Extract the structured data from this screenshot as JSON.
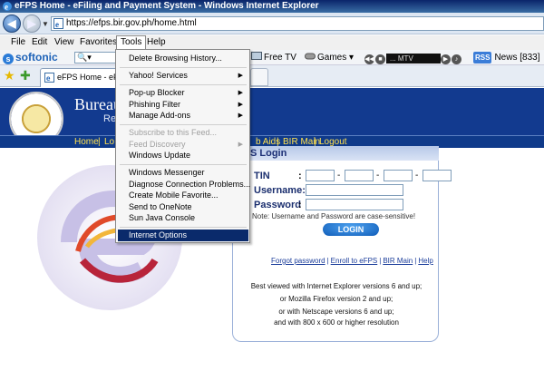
{
  "window": {
    "title": "eFPS Home - eFiling and Payment System - Windows Internet Explorer",
    "address": "https://efps.bir.gov.ph/home.html"
  },
  "menubar": [
    "File",
    "Edit",
    "View",
    "Favorites",
    "Tools",
    "Help"
  ],
  "toolbar": {
    "brand": "softonic",
    "free_tv": "Free TV",
    "games": "Games",
    "mtv": "... MTV",
    "news": "News [833]",
    "rss": "RSS"
  },
  "tabs": [
    {
      "label": "eFPS Home - eFiling..."
    }
  ],
  "tools_menu": {
    "items": [
      {
        "label": "Delete Browsing History...",
        "disabled": false,
        "submenu": false
      },
      {
        "label": "Yahoo! Services",
        "disabled": false,
        "submenu": true
      },
      {
        "label": "Pop-up Blocker",
        "disabled": false,
        "submenu": true
      },
      {
        "label": "Phishing Filter",
        "disabled": false,
        "submenu": true
      },
      {
        "label": "Manage Add-ons",
        "disabled": false,
        "submenu": true
      },
      {
        "label": "Subscribe to this Feed...",
        "disabled": true,
        "submenu": false
      },
      {
        "label": "Feed Discovery",
        "disabled": true,
        "submenu": true
      },
      {
        "label": "Windows Update",
        "disabled": false,
        "submenu": false
      },
      {
        "label": "Windows Messenger",
        "disabled": false,
        "submenu": false
      },
      {
        "label": "Diagnose Connection Problems...",
        "disabled": false,
        "submenu": false
      },
      {
        "label": "Create Mobile Favorite...",
        "disabled": false,
        "submenu": false
      },
      {
        "label": "Send to OneNote",
        "disabled": false,
        "submenu": false
      },
      {
        "label": "Sun Java Console",
        "disabled": false,
        "submenu": false
      },
      {
        "label": "Internet Options",
        "disabled": false,
        "submenu": false,
        "highlighted": true
      }
    ]
  },
  "page": {
    "header_title": "Bureau",
    "header_subtitle": "Rep",
    "nav": [
      "Home",
      "Lo",
      "b Aids",
      "BIR Main",
      "Logout"
    ],
    "nav_seps": [
      "|",
      "|",
      "|",
      "|"
    ],
    "login": {
      "title": "S Login",
      "tin_label": "TIN",
      "username_label": "Username:",
      "password_label": "Password",
      "colon": ":",
      "dash": "-",
      "note": "Note: Username and Password are case-sensitive!",
      "button": "LOGIN",
      "links": [
        "Forgot password",
        "Enroll to eFPS",
        "BIR Main",
        "Help"
      ],
      "link_sep": "|",
      "best_viewed": [
        "Best viewed with Internet Explorer versions 6 and up;",
        "or Mozilla Firefox version 2 and up;",
        "or with Netscape versions 6 and up;",
        "and with 800 x 600 or higher resolution"
      ]
    }
  },
  "colors": {
    "header_blue": "#123a8f",
    "nav_link_yellow": "#ffe04d",
    "menu_highlight": "#0a2a6b"
  }
}
